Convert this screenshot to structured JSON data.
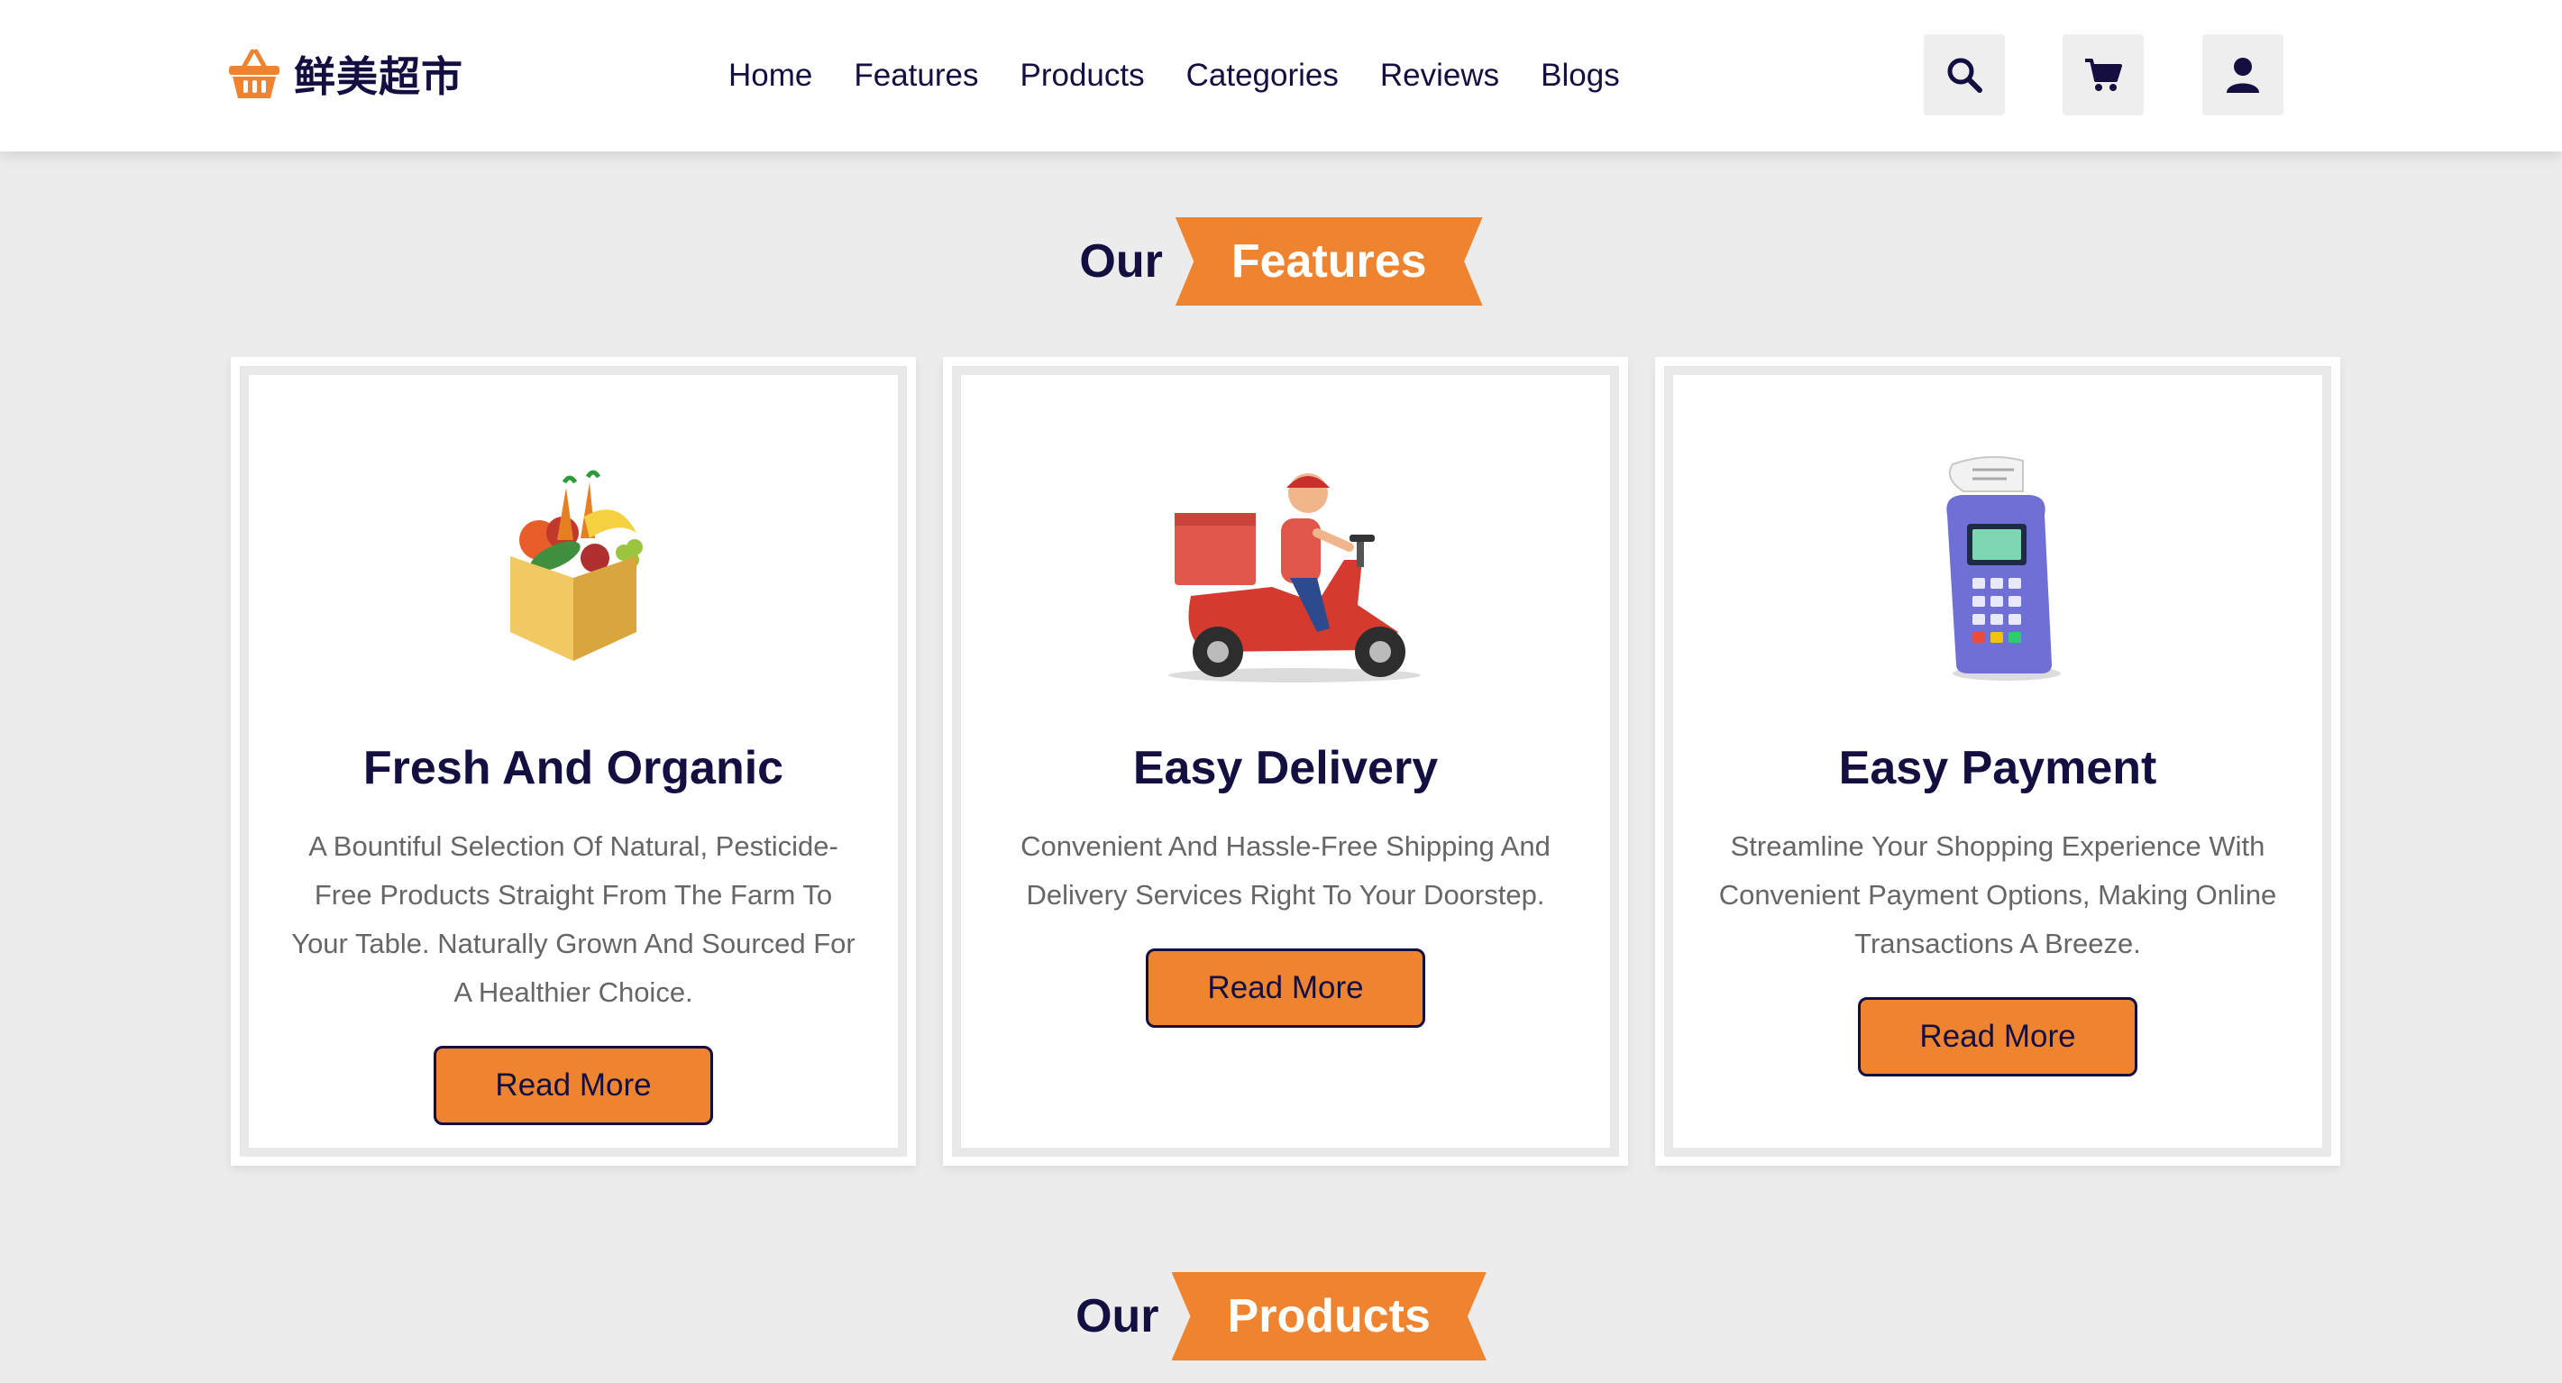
{
  "brand": {
    "name": "鲜美超市",
    "icon": "basket-icon"
  },
  "nav": [
    "Home",
    "Features",
    "Products",
    "Categories",
    "Reviews",
    "Blogs"
  ],
  "header_icons": [
    "search-icon",
    "cart-icon",
    "user-icon"
  ],
  "colors": {
    "accent": "#ee8430",
    "dark": "#130f40",
    "text_muted": "#666666",
    "background": "#ececec"
  },
  "features_heading": {
    "prefix": "Our",
    "highlight": "Features"
  },
  "features": [
    {
      "image": "grocery-box-image",
      "title": "Fresh And Organic",
      "text": "A Bountiful Selection Of Natural, Pesticide-Free Products Straight From The Farm To Your Table. Naturally Grown And Sourced For A Healthier Choice.",
      "button": "Read More"
    },
    {
      "image": "delivery-scooter-image",
      "title": "Easy Delivery",
      "text": "Convenient And Hassle-Free Shipping And Delivery Services Right To Your Doorstep.",
      "button": "Read More"
    },
    {
      "image": "payment-terminal-image",
      "title": "Easy Payment",
      "text": "Streamline Your Shopping Experience With Convenient Payment Options, Making Online Transactions A Breeze.",
      "button": "Read More"
    }
  ],
  "products_heading": {
    "prefix": "Our",
    "highlight": "Products"
  }
}
